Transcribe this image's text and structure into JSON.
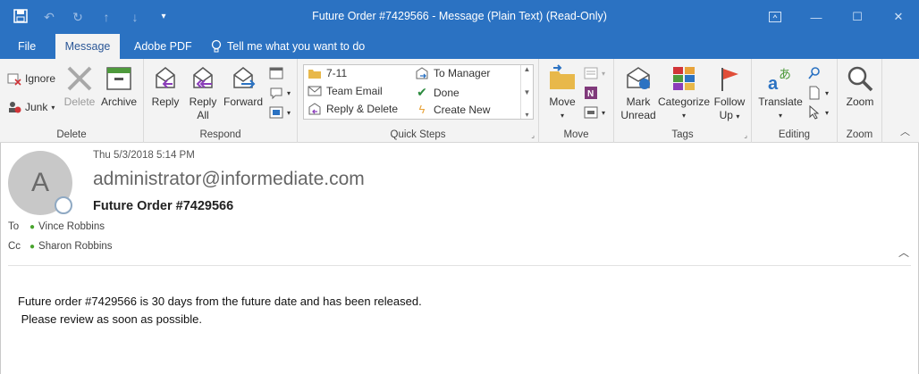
{
  "titlebar": {
    "title": "Future Order #7429566  -  Message (Plain Text) (Read-Only)"
  },
  "tabs": [
    {
      "label": "File"
    },
    {
      "label": "Message"
    },
    {
      "label": "Adobe PDF"
    },
    {
      "label": "Tell me what you want to do"
    }
  ],
  "ribbon": {
    "delete_group": {
      "label": "Delete",
      "ignore": "Ignore",
      "junk": "Junk",
      "delete": "Delete",
      "archive": "Archive"
    },
    "respond_group": {
      "label": "Respond",
      "reply": "Reply",
      "reply_all_1": "Reply",
      "reply_all_2": "All",
      "forward": "Forward"
    },
    "quick_steps": {
      "label": "Quick Steps",
      "items": [
        "7-11",
        "Team Email",
        "Reply & Delete",
        "To Manager",
        "Done",
        "Create New"
      ]
    },
    "move_group": {
      "label": "Move",
      "move": "Move"
    },
    "tags_group": {
      "label": "Tags",
      "mark_unread_1": "Mark",
      "mark_unread_2": "Unread",
      "categorize": "Categorize",
      "follow_up_1": "Follow",
      "follow_up_2": "Up"
    },
    "editing_group": {
      "label": "Editing",
      "translate": "Translate"
    },
    "zoom_group": {
      "label": "Zoom",
      "zoom": "Zoom"
    }
  },
  "message": {
    "avatar_letter": "A",
    "date": "Thu 5/3/2018 5:14 PM",
    "sender": "administrator@informediate.com",
    "subject": "Future Order #7429566",
    "to_label": "To",
    "to": "Vince Robbins",
    "cc_label": "Cc",
    "cc": "Sharon Robbins",
    "body_line1": "Future order #7429566 is 30 days from the future date and has been released.",
    "body_line2": " Please review as soon as possible."
  },
  "colors": {
    "accent": "#2b72c2",
    "ribbon_bg": "#f3f3f3"
  }
}
